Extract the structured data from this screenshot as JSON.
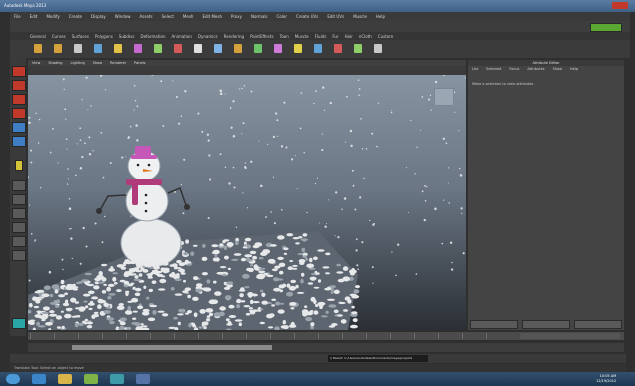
{
  "app": {
    "title": "Autodesk Maya 2013"
  },
  "menu_bar": {
    "items": [
      "File",
      "Edit",
      "Modify",
      "Create",
      "Display",
      "Window",
      "Assets",
      "Select",
      "Mesh",
      "Edit Mesh",
      "Proxy",
      "Normals",
      "Color",
      "Create UVs",
      "Edit UVs",
      "Muscle",
      "Help"
    ]
  },
  "shelf": {
    "tabs": [
      "General",
      "Curves",
      "Surfaces",
      "Polygons",
      "Subdivs",
      "Deformation",
      "Animation",
      "Dynamics",
      "Rendering",
      "PaintEffects",
      "Toon",
      "Muscle",
      "Fluids",
      "Fur",
      "Hair",
      "nCloth",
      "Custom"
    ],
    "icon_colors": [
      "#d4a13a",
      "#d4a13a",
      "#c8c8c8",
      "#5fa3d9",
      "#e3c347",
      "#c66ad1",
      "#8fcf6a",
      "#d55b5b",
      "#e0e0e0",
      "#7fb3e6",
      "#d4a13a",
      "#6cc36c",
      "#cf7ad9",
      "#e0d04a",
      "#5fa3d9",
      "#d55b5b",
      "#8fcf6a",
      "#c8c8c8"
    ]
  },
  "viewport": {
    "menu": [
      "View",
      "Shading",
      "Lighting",
      "Show",
      "Renderer",
      "Panels"
    ]
  },
  "right_panel": {
    "title": "Attribute Editor",
    "menu": [
      "List",
      "Selected",
      "Focus",
      "Attributes",
      "Show",
      "Help"
    ],
    "message": "Make a selection to view attributes",
    "buttons": [
      "Select",
      "Load Attributes",
      "Copy Tab"
    ]
  },
  "command_line": {
    "output": "// Result: C:/Users/Autodesk/Documents/maya/projects"
  },
  "help_line": {
    "text": "Translate Tool: Select an object to move"
  },
  "taskbar": {
    "time": "10:05 AM",
    "date": "12/19/2012"
  },
  "colors": {
    "viewport_top": "#8693a0",
    "viewport_bottom": "#2b2f35",
    "snowman_hat": "#c457b8",
    "snowman_scarf": "#b03a7a",
    "snow": "#e8eaec"
  }
}
